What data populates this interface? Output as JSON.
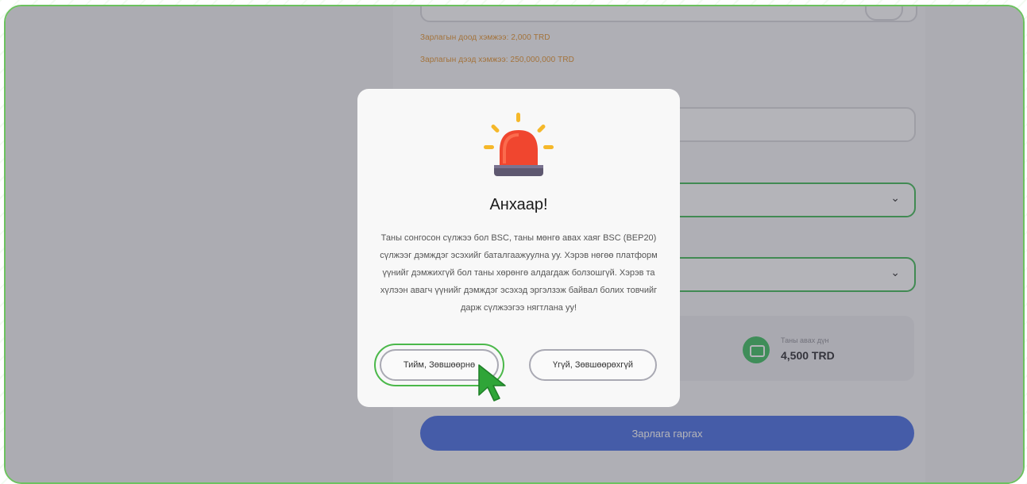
{
  "background_page": {
    "min_limit_label": "Зарлагын доод хэмжээ: 2,000 TRD",
    "max_limit_label": "Зарлагын дээд хэмжээ: 250,000,000 TRD",
    "receive_amount_label": "Таны авах дүн",
    "receive_amount_value": "4,500 TRD",
    "submit_label": "Зарлага гаргах"
  },
  "modal": {
    "title": "Анхаар!",
    "message": "Таны сонгосон сүлжээ бол BSC, таны мөнгө авах хаяг BSC (BEP20) сүлжээг дэмждэг эсэхийг баталгаажуулна уу. Хэрэв нөгөө платформ үүнийг дэмжихгүй бол таны хөрөнгө алдагдаж болзошгүй. Хэрэв та хүлээн авагч үүнийг дэмждэг эсэхэд эргэлзэж байвал болих товчийг дарж сүлжээгээ нягтлана уу!",
    "confirm_label": "Тийм, Зөвшөөрнө",
    "decline_label": "Үгүй, Зөвшөөрөхгүй",
    "icon": "siren-alarm-icon"
  },
  "colors": {
    "accent_green": "#33b54a",
    "primary_blue": "#3a63e0",
    "warning_orange": "#e08a1e"
  }
}
